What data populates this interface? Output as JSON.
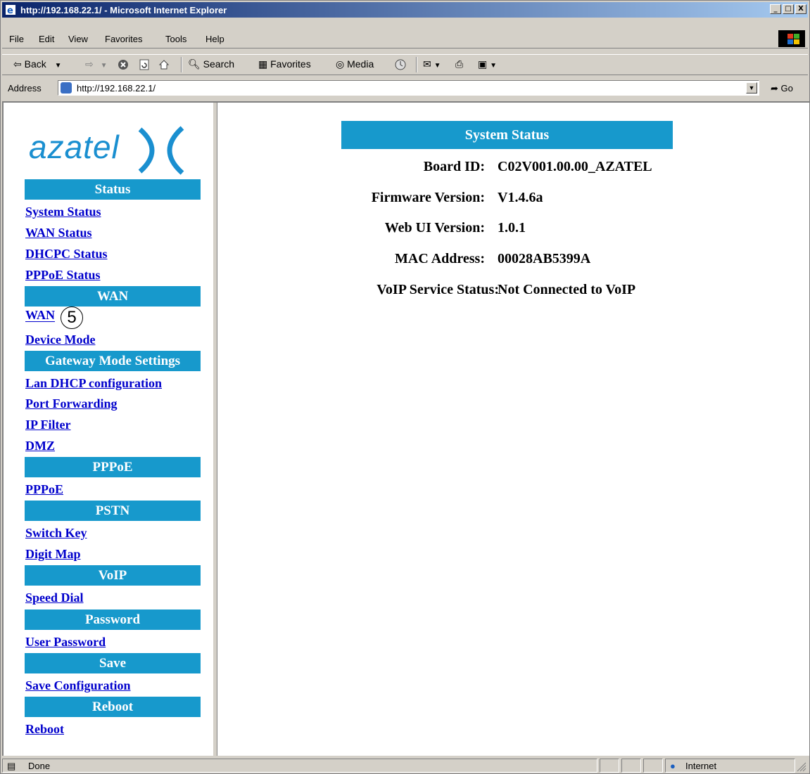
{
  "window": {
    "title": "http://192.168.22.1/ - Microsoft Internet Explorer",
    "minimize": "_",
    "maximize": "□",
    "close": "X"
  },
  "menu": [
    "File",
    "Edit",
    "View",
    "Favorites",
    "Tools",
    "Help"
  ],
  "toolbar": {
    "back": "Back",
    "search": "Search",
    "favorites": "Favorites",
    "media": "Media"
  },
  "address": {
    "label": "Address",
    "url": "http://192.168.22.1/",
    "go": "Go"
  },
  "logo": {
    "text": "azatel"
  },
  "nav": {
    "sections": [
      {
        "header": "Status"
      },
      {
        "header": "WAN"
      },
      {
        "header": "Gateway Mode Settings"
      },
      {
        "header": "PPPoE"
      },
      {
        "header": "PSTN"
      },
      {
        "header": "VoIP"
      },
      {
        "header": "Password"
      },
      {
        "header": "Save"
      },
      {
        "header": "Reboot"
      }
    ],
    "links": {
      "system_status": "System Status",
      "wan_status": "WAN Status",
      "dhcpc_status": "DHCPC Status",
      "pppoe_status": "PPPoE Status",
      "wan": "WAN",
      "device_mode": "Device Mode",
      "lan_dhcp": "Lan DHCP configuration",
      "port_forwarding": "Port Forwarding",
      "ip_filter": "IP Filter",
      "dmz": "DMZ",
      "pppoe": "PPPoE",
      "switch_key": "Switch Key",
      "digit_map": "Digit Map",
      "speed_dial": "Speed Dial",
      "user_password": "User Password",
      "save_configuration": "Save Configuration",
      "reboot": "Reboot"
    },
    "annotation": "5"
  },
  "system_status": {
    "title": "System Status",
    "rows": [
      {
        "label": "Board ID:",
        "value": "C02V001.00.00_AZATEL"
      },
      {
        "label": "Firmware Version:",
        "value": "V1.4.6a"
      },
      {
        "label": "Web UI Version:",
        "value": "1.0.1"
      },
      {
        "label": "MAC Address:",
        "value": "00028AB5399A"
      },
      {
        "label": "VoIP Service Status:",
        "value": "Not Connected to VoIP"
      }
    ]
  },
  "status_bar": {
    "left": "Done",
    "zone": "Internet"
  },
  "colors": {
    "nav_header": "#1799cc",
    "link": "#0000cc",
    "title_gradient_start": "#0a246a"
  }
}
